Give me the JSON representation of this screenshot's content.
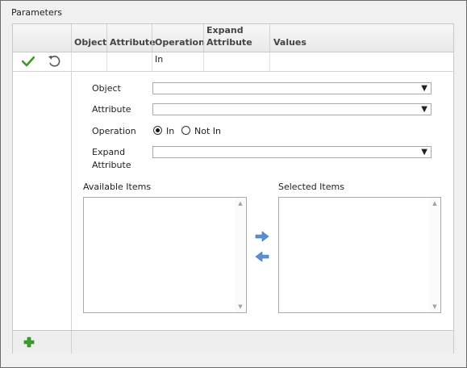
{
  "panel": {
    "title": "Parameters"
  },
  "table": {
    "headers": [
      {
        "key": "object",
        "label": "Object"
      },
      {
        "key": "attribute",
        "label": "Attribute"
      },
      {
        "key": "operation",
        "label": "Operation"
      },
      {
        "key": "expand_attribute",
        "label": "Expand Attribute"
      },
      {
        "key": "values",
        "label": "Values"
      }
    ],
    "row": {
      "object": "",
      "attribute": "",
      "operation": "In",
      "expand_attribute": "",
      "values": ""
    }
  },
  "form": {
    "object_label": "Object",
    "attribute_label": "Attribute",
    "operation_label": "Operation",
    "expand_label_1": "Expand",
    "expand_label_2": "Attribute",
    "operation_options": [
      {
        "label": "In",
        "selected": true
      },
      {
        "label": "Not In",
        "selected": false
      }
    ],
    "available_label": "Available Items",
    "selected_label": "Selected Items"
  },
  "icons": {
    "confirm": "checkmark-icon",
    "undo": "undo-icon",
    "add": "plus-icon",
    "move_right": "arrow-right-icon",
    "move_left": "arrow-left-icon"
  },
  "colors": {
    "check": "#3a9a2a",
    "arrow": "#5b8fd6",
    "add": "#3aa02a"
  }
}
